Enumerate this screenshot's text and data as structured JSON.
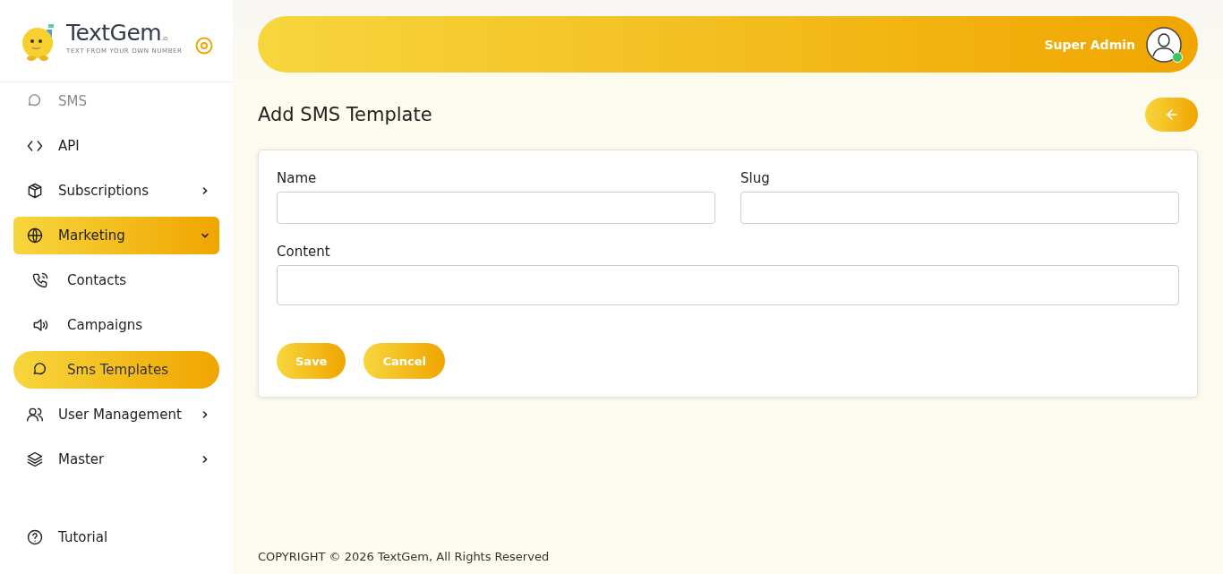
{
  "sidebar": {
    "logo": {
      "name": "TextGem",
      "suffix": ".io",
      "tagline": "TEXT FROM YOUR OWN NUMBER"
    },
    "items": [
      {
        "label": "SMS",
        "selected": false
      },
      {
        "label": "API",
        "selected": false
      },
      {
        "label": "Subscriptions",
        "selected": false,
        "expanded": false
      },
      {
        "label": "Marketing",
        "selected": true,
        "expanded": true,
        "children": [
          {
            "label": "Contacts",
            "selected": false
          },
          {
            "label": "Campaigns",
            "selected": false
          },
          {
            "label": "Sms Templates",
            "selected": true
          }
        ]
      },
      {
        "label": "User Management",
        "selected": false,
        "expanded": false
      },
      {
        "label": "Master",
        "selected": false,
        "expanded": false
      }
    ],
    "bottom_item": {
      "label": "Tutorial"
    }
  },
  "header": {
    "user": "Super Admin",
    "online": true
  },
  "page": {
    "title": "Add SMS Template",
    "fields": [
      {
        "label": "Name",
        "kind": "half"
      },
      {
        "label": "Slug",
        "kind": "half"
      },
      {
        "label": "Content",
        "kind": "full"
      }
    ],
    "buttons": [
      "Save",
      "Cancel"
    ]
  },
  "footer": "COPYRIGHT © 2026 TextGem, All Rights Reserved"
}
